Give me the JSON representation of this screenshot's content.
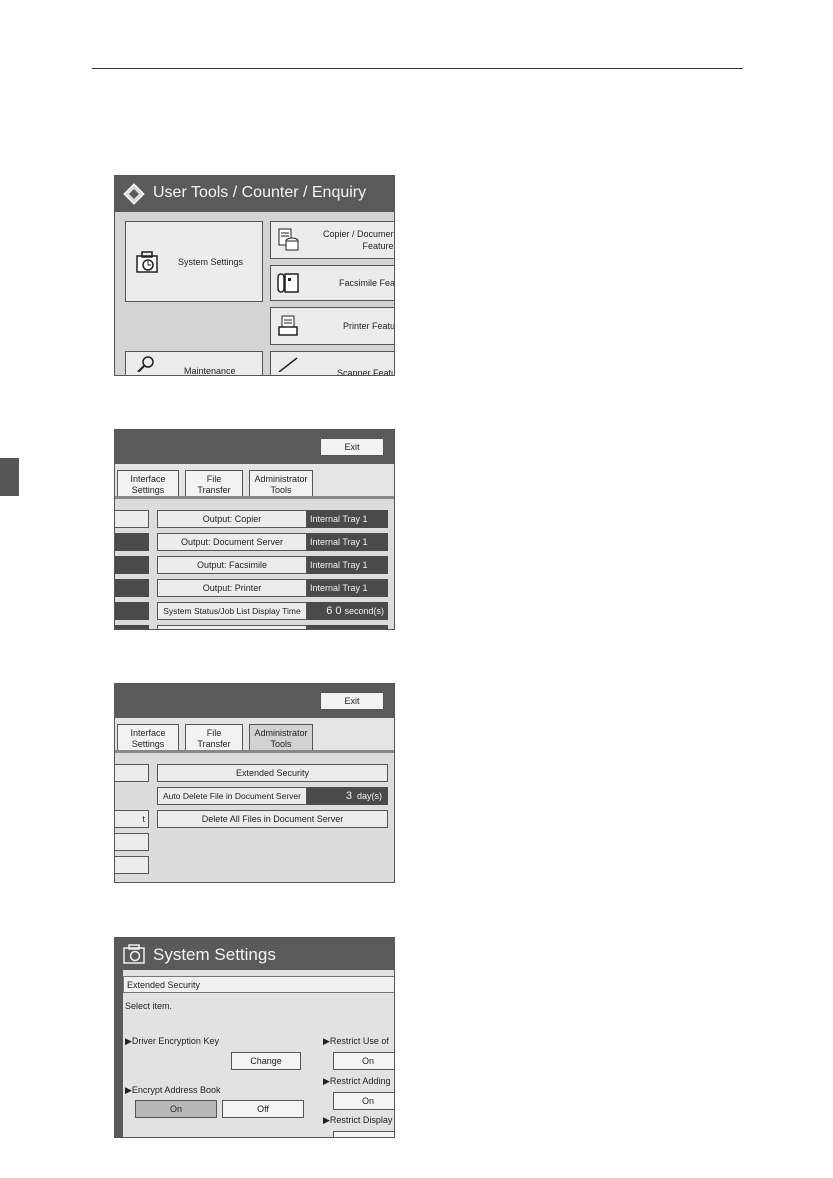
{
  "panel1": {
    "title": "User Tools / Counter / Enquiry",
    "buttons": {
      "system_settings": "System Settings",
      "copier_line1": "Copier / Document",
      "copier_line2": "Features",
      "facsimile": "Facsimile Feat",
      "printer": "Printer Featu",
      "maintenance": "Maintenance",
      "scanner": "Scanner Featu"
    }
  },
  "panel2": {
    "exit": "Exit",
    "tabs": {
      "interface": [
        "Interface",
        "Settings"
      ],
      "file": [
        "File",
        "Transfer"
      ],
      "admin": [
        "Administrator",
        "Tools"
      ]
    },
    "rows": [
      {
        "label": "Output: Copier",
        "value": "Internal Tray 1"
      },
      {
        "label": "Output: Document Server",
        "value": "Internal Tray 1"
      },
      {
        "label": "Output: Facsimile",
        "value": "Internal Tray 1"
      },
      {
        "label": "Output: Printer",
        "value": "Internal Tray 1"
      },
      {
        "label": "System Status/Job List Display Time",
        "value_num": "6 0",
        "value_unit": "second(s)"
      }
    ]
  },
  "panel3": {
    "exit": "Exit",
    "tabs": {
      "interface": [
        "Interface",
        "Settings"
      ],
      "file": [
        "File",
        "Transfer"
      ],
      "admin": [
        "Administrator",
        "Tools"
      ]
    },
    "extended_security": "Extended Security",
    "auto_delete": {
      "label": "Auto Delete File in Document Server",
      "value_num": "3",
      "value_unit": "day(s)"
    },
    "delete_all": "Delete All Files in Document Server",
    "left_stub": "t"
  },
  "panel4": {
    "title": "System Settings",
    "breadcrumb": "Extended Security",
    "instruction": "Select item.",
    "driver_key_label": "▶Driver Encryption Key",
    "change": "Change",
    "encrypt_label": "▶Encrypt Address Book",
    "on": "On",
    "off": "Off",
    "restrict_use": "▶Restrict Use of",
    "restrict_use_value": "On",
    "restrict_adding": "▶Restrict Adding",
    "restrict_adding_value": "On",
    "restrict_display": "▶Restrict Display"
  }
}
